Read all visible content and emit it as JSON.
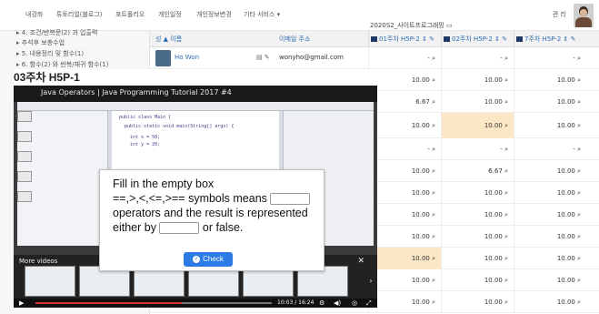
{
  "nav": {
    "items": [
      "내강좌",
      "튜토리얼(블로그)",
      "포트폴리오",
      "개인일정",
      "개인정보변경",
      "기타 서비스 ▾"
    ],
    "user": "관 리"
  },
  "sidebar": {
    "items": [
      "▸ 4. 조건/반복문(2) 과 입출력",
      "▸ 추석후 보충수업",
      "▸ 5. 내용정리 및 함수(1)",
      "▸ 6. 함수(2) 와 반복/재귀 함수(1)"
    ]
  },
  "gradebook": {
    "title": "2020S2_사이트프로그래밍 ▭",
    "headers": {
      "name": "성 ▲ 이름",
      "email": "이메일 주소",
      "col1": "01주차 H5P-2 ⇕ ✎",
      "col2": "02주차 H5P-2 ⇕ ✎",
      "col3": "7주차 H5P-2 ⇕ ✎"
    },
    "first_row": {
      "name": "Ho Won",
      "email": "wonyho@gmail.com",
      "icons": "▤ ✎"
    },
    "rows": [
      [
        "- ⌕",
        "- ⌕",
        "- ⌕"
      ],
      [
        "10.00 ⌕",
        "10.00 ⌕",
        "10.00 ⌕"
      ],
      [
        "6.67 ⌕",
        "10.00 ⌕",
        "10.00 ⌕"
      ],
      [
        "10.00 ⌕",
        "10.00 ⌕",
        "10.00 ⌕"
      ],
      [
        "- ⌕",
        "- ⌕",
        "- ⌕"
      ],
      [
        "10.00 ⌕",
        "6.67 ⌕",
        "10.00 ⌕"
      ],
      [
        "10.00 ⌕",
        "10.00 ⌕",
        "10.00 ⌕"
      ],
      [
        "10.00 ⌕",
        "10.00 ⌕",
        "10.00 ⌕"
      ],
      [
        "10.00 ⌕",
        "10.00 ⌕",
        "10.00 ⌕"
      ],
      [
        "10.00 ⌕",
        "10.00 ⌕",
        "10.00 ⌕"
      ],
      [
        "10.00 ⌕",
        "10.00 ⌕",
        "10.00 ⌕"
      ],
      [
        "10.00 ⌕",
        "10.00 ⌕",
        "10.00 ⌕"
      ]
    ]
  },
  "video": {
    "title": "03주차 H5P-1",
    "player_title": "Java Operators | Java Programming Tutorial 2017 #4",
    "quiz": {
      "line1": "Fill in the empty box",
      "line2": "==,>,<,<=,>== symbols means",
      "line3": "operators and the result is represented",
      "line4a": "either by",
      "line4b": "or false.",
      "check_label": "Check"
    },
    "more_videos_label": "More videos",
    "time": "10:03 / 16:24",
    "progress": 0.62
  },
  "colors": {
    "highlight": "#fbe7c6",
    "link": "#2f6db3",
    "check_button": "#2c7be5"
  }
}
